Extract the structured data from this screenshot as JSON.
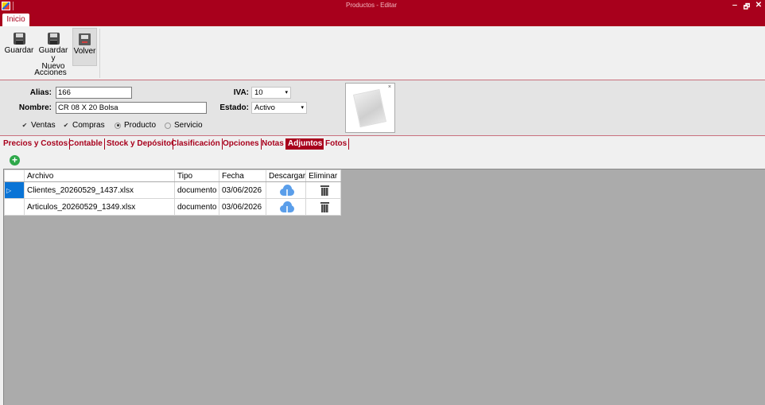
{
  "window": {
    "title": "Productos - Editar",
    "minimize": "‒",
    "restore": "🗗",
    "close": "✕"
  },
  "ribbon": {
    "tab": "Inicio",
    "buttons": {
      "guardar": "Guardar",
      "guardar_nuevo_1": "Guardar y",
      "guardar_nuevo_2": "Nuevo",
      "volver": "Volver"
    },
    "group_label": "Acciones"
  },
  "form": {
    "alias_label": "Alias:",
    "alias_value": "166",
    "nombre_label": "Nombre:",
    "nombre_value": "CR 08 X 20 Bolsa",
    "iva_label": "IVA:",
    "iva_value": "10",
    "estado_label": "Estado:",
    "estado_value": "Activo",
    "ventas": "Ventas",
    "compras": "Compras",
    "producto": "Producto",
    "servicio": "Servicio",
    "check_mark": "✔",
    "photo_close": "×"
  },
  "tabs": [
    "Precios y Costos",
    "Contable",
    "Stock y Depósito",
    "Clasificación",
    "Opciones",
    "Notas",
    "Adjuntos",
    "Fotos"
  ],
  "toolbar": {
    "add": "+"
  },
  "grid": {
    "columns": [
      "Archivo",
      "Tipo",
      "Fecha",
      "Descargar",
      "Eliminar"
    ],
    "row_marker": "▷",
    "rows": [
      {
        "archivo": "Clientes_20260529_1437.xlsx",
        "tipo": "documento",
        "fecha": "03/06/2026"
      },
      {
        "archivo": "Articulos_20260529_1349.xlsx",
        "tipo": "documento",
        "fecha": "03/06/2026"
      }
    ]
  },
  "colors": {
    "accent": "#a8001c",
    "grid_bg": "#ababab",
    "selected": "#0a74d6",
    "download": "#5a9eea"
  },
  "icons": {
    "save": "floppy-icon",
    "save_new": "floppy-icon",
    "back": "door-icon",
    "add": "plus-circle-icon",
    "download": "cloud-download-icon",
    "delete": "trash-icon"
  }
}
